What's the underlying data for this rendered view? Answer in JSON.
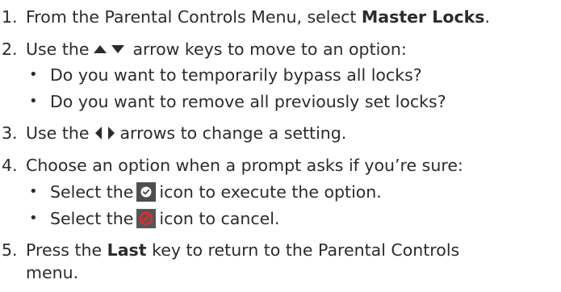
{
  "steps": [
    {
      "number": "1.",
      "pre": "From the Parental Controls Menu, select ",
      "bold": "Master Locks",
      "post": "."
    },
    {
      "number": "2.",
      "pre": "Use the",
      "post": "arrow keys to move to an option:",
      "icons": [
        "arrow-up-icon",
        "arrow-down-icon"
      ],
      "bullets": [
        "Do you want to temporarily bypass all locks?",
        "Do you want to remove all previously set locks?"
      ]
    },
    {
      "number": "3.",
      "pre": "Use the",
      "post": "arrows to change a setting.",
      "icons": [
        "arrow-left-icon",
        "arrow-right-icon"
      ]
    },
    {
      "number": "4.",
      "text": "Choose an option when a prompt asks if you’re sure:",
      "bullets": [
        {
          "pre": "Select the",
          "icon": "checkmark-icon",
          "post": "icon to execute the option."
        },
        {
          "pre": "Select the",
          "icon": "cancel-icon",
          "post": "icon to cancel."
        }
      ]
    },
    {
      "number": "5.",
      "pre": "Press the ",
      "bold": "Last",
      "post": " key to return to the Parental Controls",
      "continuation": "menu."
    }
  ],
  "bullet_glyph": "•",
  "colors": {
    "text": "#2b2b2b",
    "icon_background_dark": "#4e4e4e",
    "icon_check": "#ffffff",
    "icon_cancel": "#e8282a"
  }
}
